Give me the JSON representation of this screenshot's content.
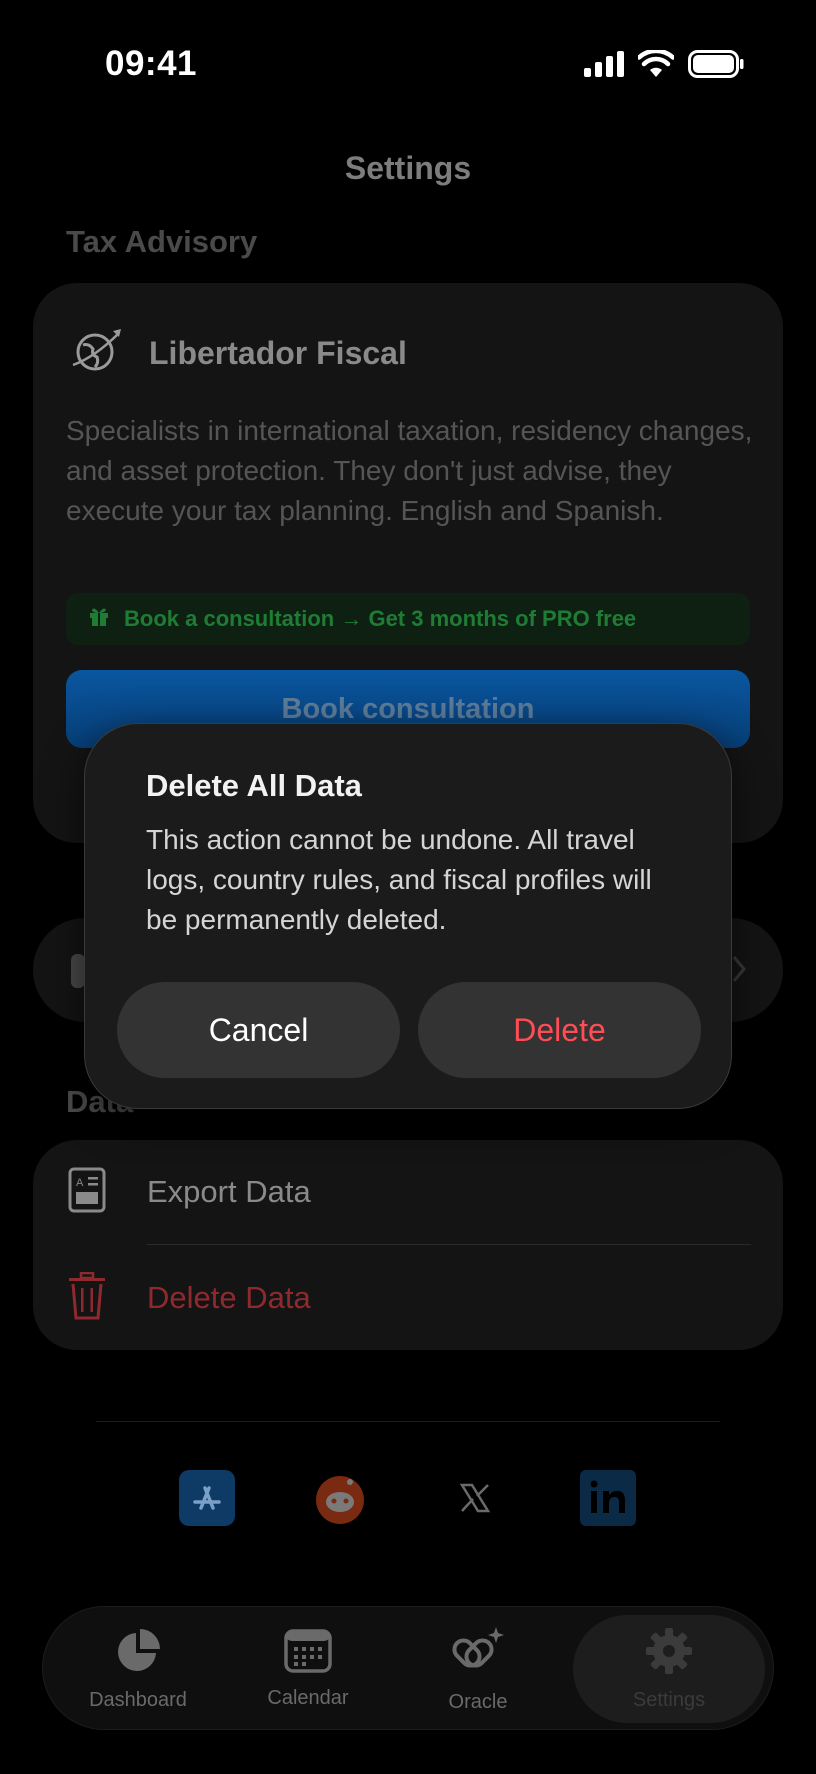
{
  "status": {
    "time": "09:41"
  },
  "nav": {
    "title": "Settings"
  },
  "tax_section": {
    "title": "Tax Advisory",
    "advisor": {
      "name": "Libertador Fiscal",
      "description": "Specialists in international taxation, residency changes, and asset protection. They don't just advise, they execute your tax planning. English and Spanish.",
      "promo": "Book a consultation → Get 3 months of PRO free",
      "button": "Book consultation"
    }
  },
  "data_section": {
    "title": "Data",
    "items": [
      {
        "label": "Export Data",
        "icon": "export-document-icon"
      },
      {
        "label": "Delete Data",
        "icon": "trash-icon"
      }
    ]
  },
  "social": [
    {
      "icon": "app-store-icon"
    },
    {
      "icon": "reddit-icon"
    },
    {
      "icon": "x-icon"
    },
    {
      "icon": "linkedin-icon"
    }
  ],
  "tabbar": {
    "tabs": [
      {
        "label": "Dashboard",
        "icon": "pie-chart-icon"
      },
      {
        "label": "Calendar",
        "icon": "calendar-icon"
      },
      {
        "label": "Oracle",
        "icon": "oracle-sparkle-icon"
      },
      {
        "label": "Settings",
        "icon": "gear-icon",
        "active": true
      }
    ]
  },
  "dialog": {
    "title": "Delete All Data",
    "message": "This action cannot be undone. All travel logs, country rules, and fiscal profiles will be permanently deleted.",
    "cancel": "Cancel",
    "confirm": "Delete"
  },
  "colors": {
    "destructive": "#ff4d55",
    "accent_blue": "#0a84ff",
    "promo_green": "#30d158"
  }
}
